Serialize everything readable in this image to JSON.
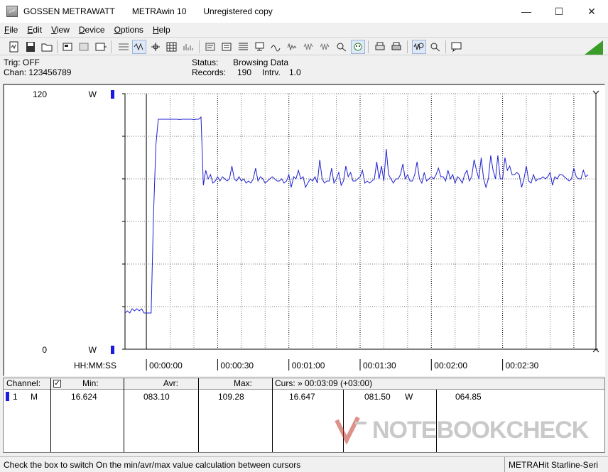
{
  "titlebar": {
    "company": "GOSSEN METRAWATT",
    "app": "METRAwin 10",
    "license": "Unregistered copy",
    "minimize": "—",
    "maximize": "☐",
    "close": "✕"
  },
  "menu": {
    "items": [
      {
        "label": "File",
        "key": "F",
        "rest": "ile"
      },
      {
        "label": "Edit",
        "key": "E",
        "rest": "dit"
      },
      {
        "label": "View",
        "key": "V",
        "rest": "iew"
      },
      {
        "label": "Device",
        "key": "D",
        "rest": "evice"
      },
      {
        "label": "Options",
        "key": "O",
        "rest": "ptions"
      },
      {
        "label": "Help",
        "key": "H",
        "rest": "elp"
      }
    ]
  },
  "toolbar": {
    "icons": [
      "new-file-icon",
      "save-icon",
      "open-folder-icon",
      "device-settings-icon",
      "device-read-icon",
      "device-export-icon",
      "text-view-icon",
      "wave-view-icon",
      "cursor-view-icon",
      "table-view-icon",
      "bar-view-icon",
      "config-icon",
      "list-config-icon",
      "records-icon",
      "monitor-icon",
      "signal-icon",
      "signal-icon-2",
      "wave-icon-a",
      "wave-icon-b",
      "scope-icon",
      "face-icon",
      "print-icon",
      "print-setup-icon",
      "zoom-wave-icon",
      "zoom-select-icon",
      "message-icon"
    ],
    "accent": "#3a9d2a"
  },
  "status": {
    "trig": "Trig: OFF",
    "chan": "Chan:  123456789",
    "status_label": "Status:",
    "status_value": "Browsing Data",
    "records_label": "Records:",
    "records_value": "190",
    "intrv_label": "Intrv.",
    "intrv_value": "1.0"
  },
  "chart": {
    "y_max_label": "120",
    "y_min_label": "0",
    "unit": "W",
    "time_axis_label": "HH:MM:SS",
    "time_ticks": [
      "00:00:00",
      "00:00:30",
      "00:01:00",
      "00:01:30",
      "00:02:00",
      "00:02:30"
    ],
    "line_color": "#2020d0",
    "marker_color": "#1a1ae0"
  },
  "chart_data": {
    "type": "line",
    "xlabel": "HH:MM:SS",
    "ylabel": "W",
    "ylim": [
      0,
      120
    ],
    "xlim_seconds": [
      -9,
      189
    ],
    "grid": true,
    "series": [
      {
        "name": "1 M",
        "x_start_seconds": -9,
        "x_step_seconds": 1,
        "values": [
          17,
          18,
          17,
          19,
          18,
          19,
          18,
          19,
          17,
          17,
          17,
          17,
          63,
          96,
          108,
          108,
          108,
          108,
          108,
          108,
          108,
          108,
          108,
          107.8,
          108,
          108,
          108,
          108,
          108,
          107.8,
          108,
          108,
          109,
          77,
          84,
          80,
          82,
          78,
          79,
          81,
          79,
          81,
          80,
          79,
          80,
          86,
          80,
          79,
          81,
          79,
          80,
          78,
          79,
          78,
          80,
          85,
          79,
          81,
          80,
          78,
          79,
          80,
          81,
          80,
          79,
          79,
          80,
          78,
          79,
          82,
          76,
          81,
          80,
          84,
          80,
          81,
          76,
          78,
          80,
          79,
          81,
          78,
          89,
          80,
          78,
          79,
          79,
          85,
          78,
          80,
          83,
          77,
          79,
          86,
          81,
          83,
          79,
          79,
          80,
          81,
          84,
          78,
          79,
          78,
          79,
          80,
          88,
          80,
          86,
          79,
          94,
          82,
          80,
          78,
          80,
          80,
          82,
          87,
          80,
          82,
          79,
          79,
          82,
          88,
          80,
          78,
          83,
          79,
          80,
          81,
          80,
          82,
          85,
          81,
          81,
          79,
          84,
          80,
          82,
          78,
          81,
          80,
          78,
          82,
          84,
          79,
          81,
          89,
          84,
          80,
          90,
          80,
          76,
          80,
          91,
          84,
          80,
          91,
          80,
          80,
          90,
          84,
          86,
          82,
          82,
          83,
          82,
          76,
          80,
          86,
          79,
          78,
          82,
          79,
          80,
          80,
          81,
          80,
          81,
          83,
          77,
          81,
          80,
          82,
          82,
          81,
          80,
          79,
          80,
          85,
          81,
          80,
          80,
          84,
          81,
          82
        ]
      }
    ]
  },
  "table": {
    "headers": {
      "channel": "Channel:",
      "min": "Min:",
      "avr": "Avr:",
      "max": "Max:",
      "curs": "Curs: » 00:03:09 (+03:00)"
    },
    "checkbox_checked": true,
    "row": {
      "channel_no": "1",
      "channel_mode": "M",
      "min": "16.624",
      "avr": "083.10",
      "max": "109.28",
      "curs_a": "16.647",
      "curs_b": "081.50",
      "curs_unit": "W",
      "curs_c": "064.85"
    }
  },
  "watermark": {
    "text": "NOTEBOOKCHECK"
  },
  "statusbar": {
    "hint": "Check the box to switch On the min/avr/max value calculation between cursors",
    "device": "METRAHit Starline-Seri"
  }
}
